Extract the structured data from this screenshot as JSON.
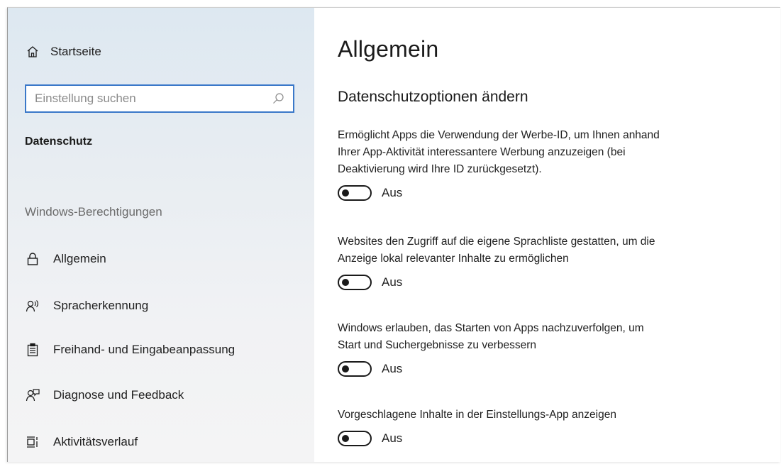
{
  "sidebar": {
    "home_label": "Startseite",
    "search_placeholder": "Einstellung suchen",
    "section_title": "Datenschutz",
    "group_title": "Windows-Berechtigungen",
    "items": [
      {
        "label": "Allgemein",
        "icon": "lock-icon"
      },
      {
        "label": "Spracherkennung",
        "icon": "speech-icon"
      },
      {
        "label": "Freihand- und Eingabeanpassung",
        "icon": "clipboard-icon"
      },
      {
        "label": "Diagnose und Feedback",
        "icon": "feedback-icon"
      },
      {
        "label": "Aktivitätsverlauf",
        "icon": "timeline-icon"
      }
    ]
  },
  "main": {
    "title": "Allgemein",
    "subtitle": "Datenschutzoptionen ändern",
    "options": [
      {
        "line1": "Ermöglicht Apps die Verwendung der Werbe-ID, um Ihnen anhand",
        "line2": "Ihrer App-Aktivität interessantere Werbung anzuzeigen (bei",
        "line3": "Deaktivierung wird Ihre ID zurückgesetzt).",
        "state": "Aus"
      },
      {
        "line1": "Websites den Zugriff auf die eigene Sprachliste gestatten, um die",
        "line2": "Anzeige lokal relevanter Inhalte zu ermöglichen",
        "state": "Aus"
      },
      {
        "line1": "Windows erlauben, das Starten von Apps nachzuverfolgen, um",
        "line2": "Start und Suchergebnisse zu verbessern",
        "state": "Aus"
      },
      {
        "line1": "Vorgeschlagene Inhalte in der Einstellungs-App anzeigen",
        "state": "Aus"
      }
    ]
  },
  "colors": {
    "accent": "#3a78c9",
    "sidebar_bg": "#e4ebf2"
  }
}
